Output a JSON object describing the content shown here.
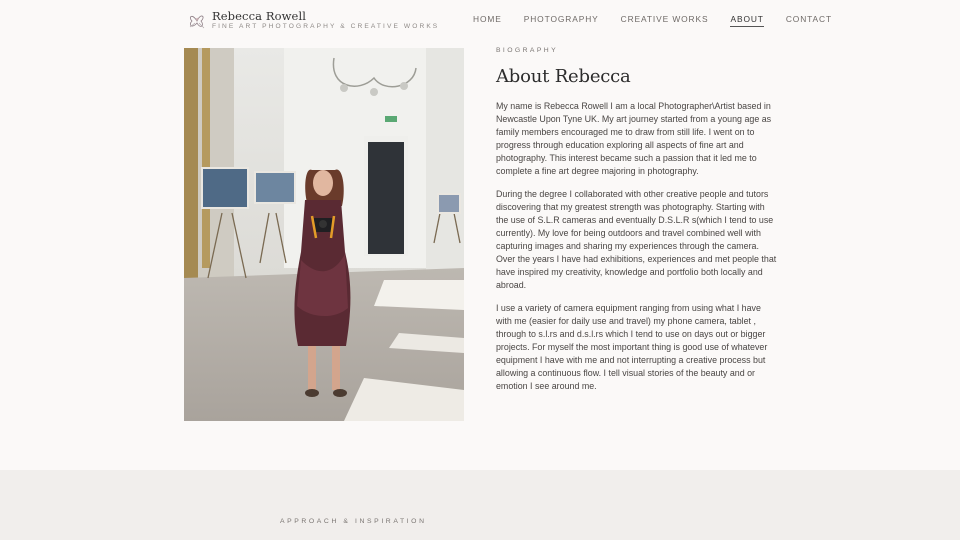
{
  "site": {
    "name": "Rebecca Rowell",
    "tagline": "FINE ART PHOTOGRAPHY & CREATIVE WORKS",
    "logo_icon": "flower-sketch-icon"
  },
  "nav": {
    "items": [
      {
        "label": "HOME"
      },
      {
        "label": "PHOTOGRAPHY"
      },
      {
        "label": "CREATIVE WORKS"
      },
      {
        "label": "ABOUT",
        "active": true
      },
      {
        "label": "CONTACT"
      }
    ]
  },
  "biography": {
    "eyebrow": "BIOGRAPHY",
    "title": "About Rebecca",
    "paragraphs": [
      "My name is Rebecca Rowell I am a local Photographer\\Artist based in Newcastle Upon Tyne UK. My art journey started from a young age as family members encouraged me to draw from still life. I went on to progress through education exploring all aspects of fine art and photography. This interest became such a passion that it led me to complete a fine art degree majoring in photography.",
      "During the degree I collaborated with other creative people and tutors discovering that my greatest strength was photography. Starting with the use of S.L.R cameras and eventually D.S.L.R s(which I tend to use currently). My love for being outdoors and travel combined well with capturing images and sharing my experiences through the camera. Over the years I have had exhibitions, experiences and met people that have inspired my creativity, knowledge and portfolio both locally and abroad.",
      "I use a variety of camera equipment ranging from using what I have with me (easier for daily use and travel) my phone camera, tablet , through to s.l.rs and d.s.l.rs which I tend to use on days out or bigger projects. For myself the most important thing is good use of whatever equipment I have with me and not interrupting a creative process but allowing a continuous flow. I tell visual stories of the beauty and or emotion I see around me."
    ]
  },
  "approach": {
    "eyebrow": "APPROACH & INSPIRATION"
  },
  "colors": {
    "background": "#fbf9f8",
    "band": "#f1eeec",
    "text": "#4a4644",
    "heading": "#2c2c2c"
  }
}
